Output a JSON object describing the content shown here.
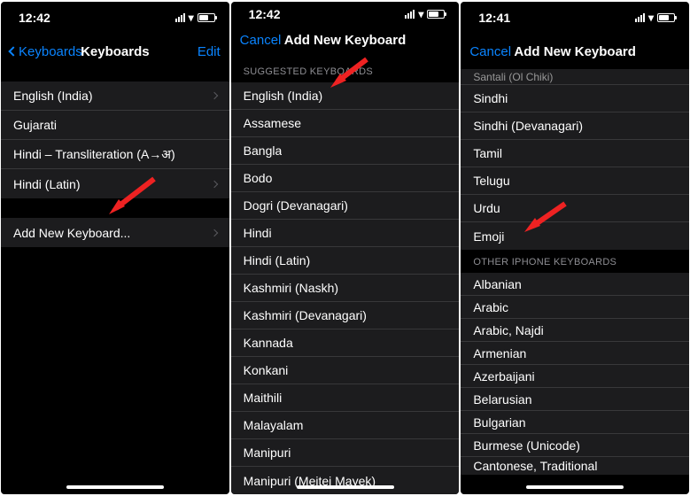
{
  "screen1": {
    "time": "12:42",
    "nav": {
      "back": "Keyboards",
      "title": "Keyboards",
      "edit": "Edit"
    },
    "keyboards": [
      "English (India)",
      "Gujarati",
      "Hindi – Transliteration (A→अ)",
      "Hindi (Latin)"
    ],
    "add_new": "Add New Keyboard..."
  },
  "screen2": {
    "time": "12:42",
    "nav": {
      "cancel": "Cancel",
      "title": "Add New Keyboard"
    },
    "section_header": "Suggested Keyboards",
    "items": [
      "English (India)",
      "Assamese",
      "Bangla",
      "Bodo",
      "Dogri (Devanagari)",
      "Hindi",
      "Hindi (Latin)",
      "Kashmiri (Naskh)",
      "Kashmiri (Devanagari)",
      "Kannada",
      "Konkani",
      "Maithili",
      "Malayalam",
      "Manipuri",
      "Manipuri (Meitei Mayek)"
    ]
  },
  "screen3": {
    "time": "12:41",
    "nav": {
      "cancel": "Cancel",
      "title": "Add New Keyboard"
    },
    "top_items": [
      "Santali (Ol Chiki)",
      "Sindhi",
      "Sindhi (Devanagari)",
      "Tamil",
      "Telugu",
      "Urdu",
      "Emoji"
    ],
    "section_header": "Other iPhone Keyboards",
    "other_items": [
      "Albanian",
      "Arabic",
      "Arabic, Najdi",
      "Armenian",
      "Azerbaijani",
      "Belarusian",
      "Bulgarian",
      "Burmese (Unicode)",
      "Cantonese, Traditional"
    ]
  }
}
